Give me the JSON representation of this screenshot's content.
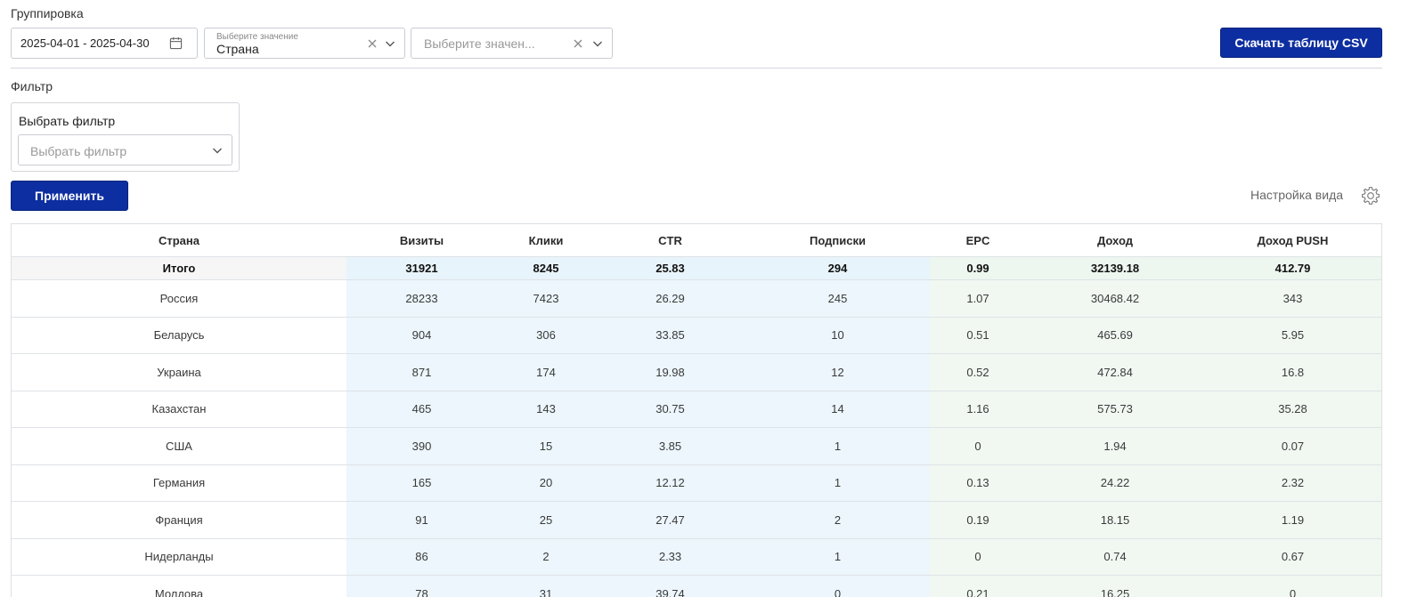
{
  "grouping": {
    "label": "Группировка",
    "date_range": "2025-04-01 - 2025-04-30",
    "select1": {
      "small_label": "Выберите значение",
      "value": "Страна"
    },
    "select2": {
      "placeholder": "Выберите значен..."
    },
    "download_label": "Скачать таблицу CSV"
  },
  "filter": {
    "label": "Фильтр",
    "box_title": "Выбрать фильтр",
    "placeholder": "Выбрать фильтр",
    "apply_label": "Применить"
  },
  "view_settings_label": "Настройка вида",
  "table": {
    "columns": [
      "Страна",
      "Визиты",
      "Клики",
      "CTR",
      "Подписки",
      "EPC",
      "Доход",
      "Доход PUSH"
    ],
    "total": [
      "Итого",
      "31921",
      "8245",
      "25.83",
      "294",
      "0.99",
      "32139.18",
      "412.79"
    ],
    "rows": [
      [
        "Россия",
        "28233",
        "7423",
        "26.29",
        "245",
        "1.07",
        "30468.42",
        "343"
      ],
      [
        "Беларусь",
        "904",
        "306",
        "33.85",
        "10",
        "0.51",
        "465.69",
        "5.95"
      ],
      [
        "Украина",
        "871",
        "174",
        "19.98",
        "12",
        "0.52",
        "472.84",
        "16.8"
      ],
      [
        "Казахстан",
        "465",
        "143",
        "30.75",
        "14",
        "1.16",
        "575.73",
        "35.28"
      ],
      [
        "США",
        "390",
        "15",
        "3.85",
        "1",
        "0",
        "1.94",
        "0.07"
      ],
      [
        "Германия",
        "165",
        "20",
        "12.12",
        "1",
        "0.13",
        "24.22",
        "2.32"
      ],
      [
        "Франция",
        "91",
        "25",
        "27.47",
        "2",
        "0.19",
        "18.15",
        "1.19"
      ],
      [
        "Нидерланды",
        "86",
        "2",
        "2.33",
        "1",
        "0",
        "0.74",
        "0.67"
      ],
      [
        "Молдова",
        "78",
        "31",
        "39.74",
        "0",
        "0.21",
        "16.25",
        "0"
      ]
    ]
  },
  "colors": {
    "primary_button": "#0d2ea0",
    "metric_blue_bg": "#ecf6fc",
    "metric_green_bg": "#f1f8f2"
  }
}
